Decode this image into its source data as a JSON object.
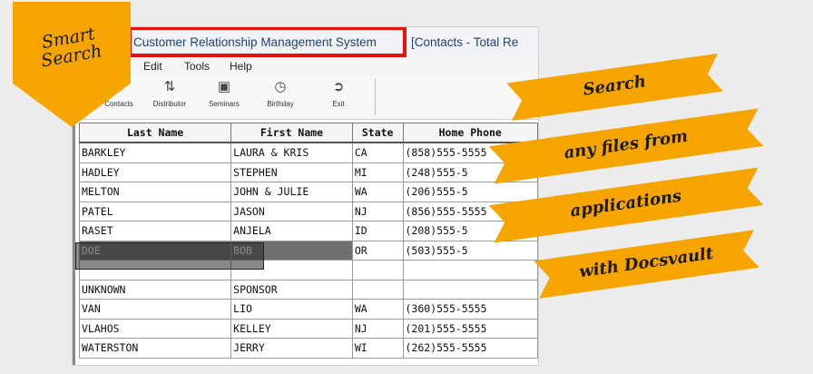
{
  "window": {
    "title": "Customer Relationship Management System",
    "title_suffix": "[Contacts - Total Re"
  },
  "menu": [
    "Edit",
    "Tools",
    "Help"
  ],
  "toolbar": [
    {
      "label": "Contacts",
      "icon": "contacts-icon"
    },
    {
      "label": "Distributor",
      "icon": "distributor-icon"
    },
    {
      "label": "Seminars",
      "icon": "seminars-icon"
    },
    {
      "label": "Birthday",
      "icon": "birthday-icon"
    },
    {
      "label": "Exit",
      "icon": "exit-icon"
    }
  ],
  "table": {
    "columns": [
      "Last Name",
      "First Name",
      "State",
      "Home Phone"
    ],
    "rows": [
      [
        "BARKLEY",
        "LAURA & KRIS",
        "CA",
        "(858)555-5555"
      ],
      [
        "HADLEY",
        "STEPHEN",
        "MI",
        "(248)555-5"
      ],
      [
        "MELTON",
        "JOHN & JULIE",
        "WA",
        "(206)555-5"
      ],
      [
        "PATEL",
        "JASON",
        "NJ",
        "(856)555-5555"
      ],
      [
        "RASET",
        "ANJELA",
        "ID",
        "(208)555-5"
      ],
      [
        "DOE",
        "BOB",
        "OR",
        "(503)555-5"
      ],
      [
        "",
        "",
        "",
        ""
      ],
      [
        "UNKNOWN",
        "SPONSOR",
        "",
        ""
      ],
      [
        "VAN",
        "LIO",
        "WA",
        "(360)555-5555"
      ],
      [
        "VLAHOS",
        "KELLEY",
        "NJ",
        "(201)555-5555"
      ],
      [
        "WATERSTON",
        "JERRY",
        "WI",
        "(262)555-5555"
      ]
    ],
    "selected_row": 5
  },
  "badge": {
    "line1": "Smart",
    "line2": "Search"
  },
  "ribbons": [
    "Search",
    "any files from",
    "applications",
    "with Docsvault"
  ],
  "colors": {
    "accent": "#f6a500",
    "highlight": "#e3120b",
    "title_text": "#23416f"
  }
}
